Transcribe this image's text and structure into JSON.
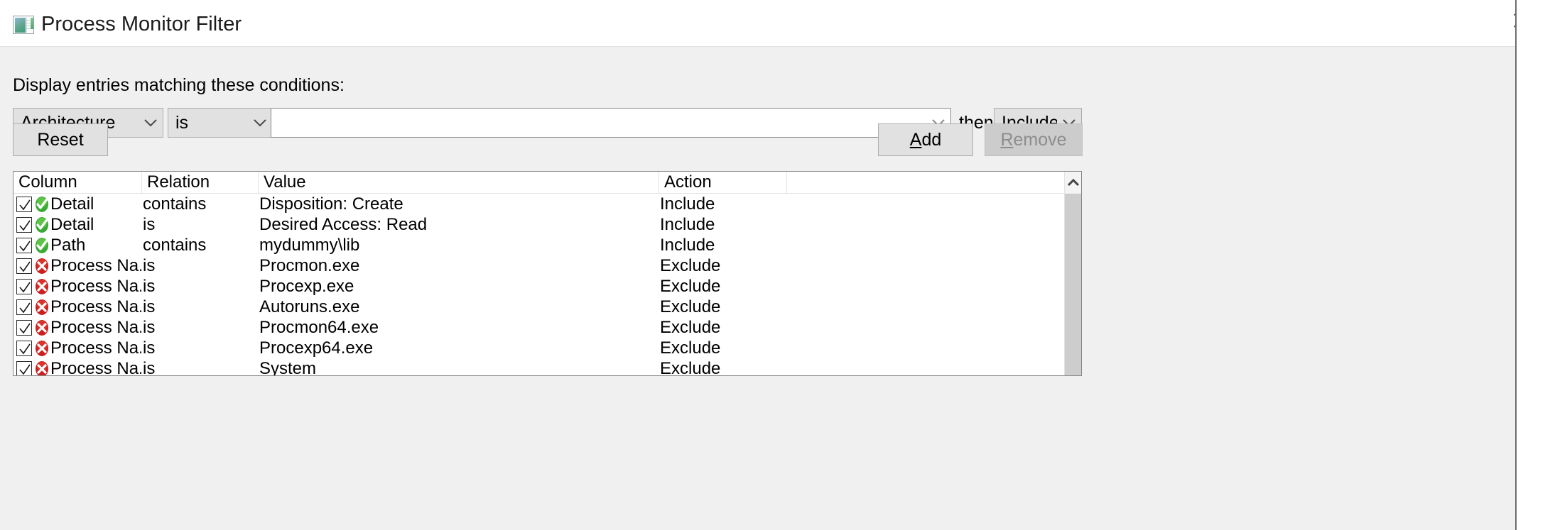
{
  "window": {
    "title": "Process Monitor Filter",
    "icon": "procmon-window-icon",
    "close_label": "✕"
  },
  "conditions": {
    "label": "Display entries matching these conditions:",
    "column_select": {
      "value": "Architecture"
    },
    "relation_select": {
      "value": "is"
    },
    "value_combo": {
      "value": "",
      "placeholder": ""
    },
    "then_label": "then",
    "action_select": {
      "value": "Include"
    }
  },
  "buttons": {
    "reset": "Reset",
    "add_prefix": "A",
    "add_suffix": "dd",
    "remove_prefix": "R",
    "remove_suffix": "emove",
    "remove_disabled": true
  },
  "list": {
    "headers": {
      "column": "Column",
      "relation": "Relation",
      "value": "Value",
      "action": "Action",
      "extra": ""
    },
    "rows": [
      {
        "checked": true,
        "icon": "include-icon",
        "column": "Detail",
        "relation": "contains",
        "value": "Disposition: Create",
        "action": "Include"
      },
      {
        "checked": true,
        "icon": "include-icon",
        "column": "Detail",
        "relation": "is",
        "value": "Desired Access: Read",
        "action": "Include"
      },
      {
        "checked": true,
        "icon": "include-icon",
        "column": "Path",
        "relation": "contains",
        "value": "mydummy\\lib",
        "action": "Include"
      },
      {
        "checked": true,
        "icon": "exclude-icon",
        "column": "Process Na...",
        "relation": "is",
        "value": "Procmon.exe",
        "action": "Exclude"
      },
      {
        "checked": true,
        "icon": "exclude-icon",
        "column": "Process Na...",
        "relation": "is",
        "value": "Procexp.exe",
        "action": "Exclude"
      },
      {
        "checked": true,
        "icon": "exclude-icon",
        "column": "Process Na...",
        "relation": "is",
        "value": "Autoruns.exe",
        "action": "Exclude"
      },
      {
        "checked": true,
        "icon": "exclude-icon",
        "column": "Process Na...",
        "relation": "is",
        "value": "Procmon64.exe",
        "action": "Exclude"
      },
      {
        "checked": true,
        "icon": "exclude-icon",
        "column": "Process Na...",
        "relation": "is",
        "value": "Procexp64.exe",
        "action": "Exclude"
      },
      {
        "checked": true,
        "icon": "exclude-icon",
        "column": "Process Na...",
        "relation": "is",
        "value": "System",
        "action": "Exclude"
      }
    ]
  },
  "scrollbar": {
    "up_arrow": "scroll-up-icon"
  },
  "colors": {
    "include_green": "#3aa935",
    "exclude_red": "#cc1f1f",
    "dialog_bg": "#f0f0f0",
    "control_bg": "#e1e1e1",
    "disabled_bg": "#cccccc"
  }
}
